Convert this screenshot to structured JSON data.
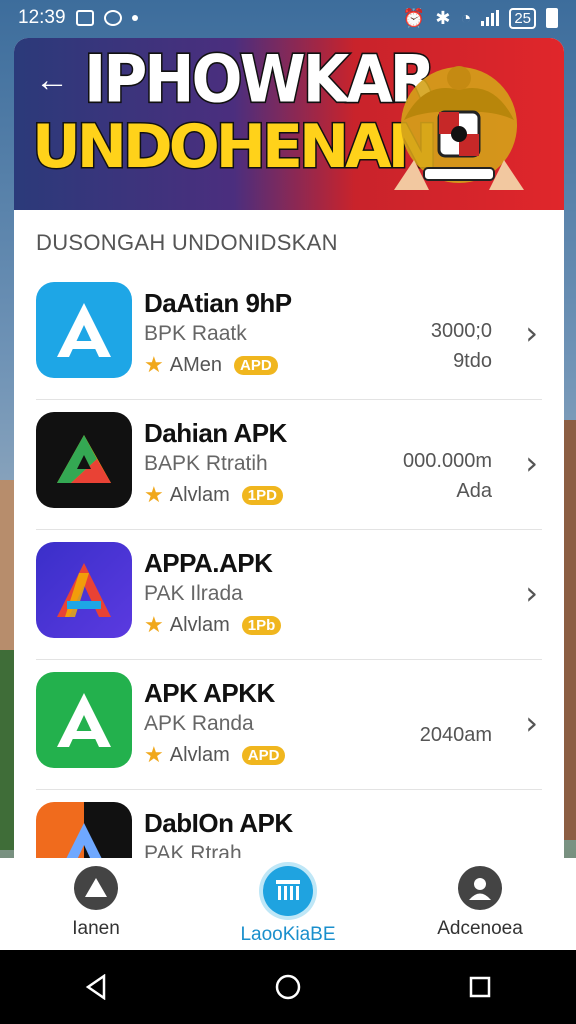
{
  "status_bar": {
    "time": "12:39",
    "battery": "25"
  },
  "banner": {
    "line1": "IPHOWKAR",
    "line2": "UNDOHENAN",
    "back_icon": "arrow-left-icon"
  },
  "section_title": "DUSONGAH UNDONIDSKAN",
  "apps": [
    {
      "name": "DaAtian 9hP",
      "sub": "BPK Raatk",
      "rating": "AMen",
      "badge": "APD",
      "meta1": "3000;0",
      "meta2": "9tdo",
      "icon_color": "#1ea6e6"
    },
    {
      "name": "Dahian APK",
      "sub": "BAPK Rtratih",
      "rating": "Alvlam",
      "badge": "1PD",
      "meta1": "000.000m",
      "meta2": "Ada",
      "icon_color": "#111111"
    },
    {
      "name": "APPA.APK",
      "sub": "PAK Ilrada",
      "rating": "Alvlam",
      "badge": "1Pb",
      "meta1": "",
      "meta2": "",
      "icon_color": "#3a2fc9"
    },
    {
      "name": "APK APKK",
      "sub": "APK Randa",
      "rating": "Alvlam",
      "badge": "APD",
      "meta1": "",
      "meta2": "2040am",
      "icon_color": "#23b14d"
    },
    {
      "name": "DabIOn APK",
      "sub": "PAK Rtrah",
      "rating": "",
      "badge": "",
      "meta1": "",
      "meta2": "",
      "icon_color": "#f06b1d"
    }
  ],
  "bottom_nav": [
    {
      "label": "Ianen",
      "icon": "home-icon",
      "active": false
    },
    {
      "label": "LaooKiaBE",
      "icon": "library-icon",
      "active": true
    },
    {
      "label": "Adcenoea",
      "icon": "account-icon",
      "active": false
    }
  ],
  "colors": {
    "accent": "#1fa3e0",
    "badge": "#f0b61e",
    "star": "#f0a81c"
  }
}
